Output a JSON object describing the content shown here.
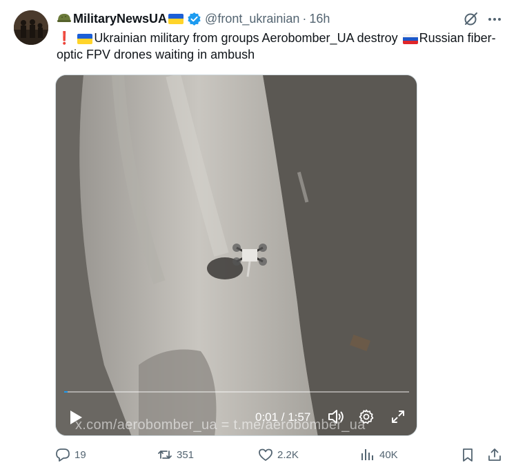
{
  "tweet": {
    "display_name": "MilitaryNewsUA",
    "handle": "@front_ukrainian",
    "separator": "·",
    "time": "16h",
    "text_part1": "Ukrainian military from groups Aerobomber_UA destroy",
    "text_part2": "Russian fiber-optic FPV drones waiting in ambush",
    "icons": {
      "avatar": "soldiers-silhouette-avatar",
      "name_emoji": "military-helmet-emoji",
      "name_flag": "ukraine-flag",
      "verified": "verified-badge-icon",
      "text_prefix": "red-exclamation-emoji",
      "text_flag_1": "ukraine-flag",
      "text_flag_2": "russia-flag",
      "grok": "grok-icon",
      "more": "more-icon"
    }
  },
  "media": {
    "watermark": "x.com/aerobomber_ua  =  t.me/aerobomber_ua",
    "current_time": "0:01",
    "duration": "1:57",
    "time_display": "0:01 / 1:57",
    "progress": 0.01,
    "controls": [
      "play-icon",
      "volume-icon",
      "settings-icon",
      "fullscreen-icon"
    ]
  },
  "actions": {
    "replies": "19",
    "reposts": "351",
    "likes": "2.2K",
    "views": "40K",
    "icons": [
      "reply-icon",
      "repost-icon",
      "like-icon",
      "views-icon",
      "bookmark-icon",
      "share-icon"
    ]
  },
  "colors": {
    "text": "#0f1419",
    "secondary": "#536471",
    "verified": "#1d9bf0",
    "border": "#cfd9de"
  }
}
